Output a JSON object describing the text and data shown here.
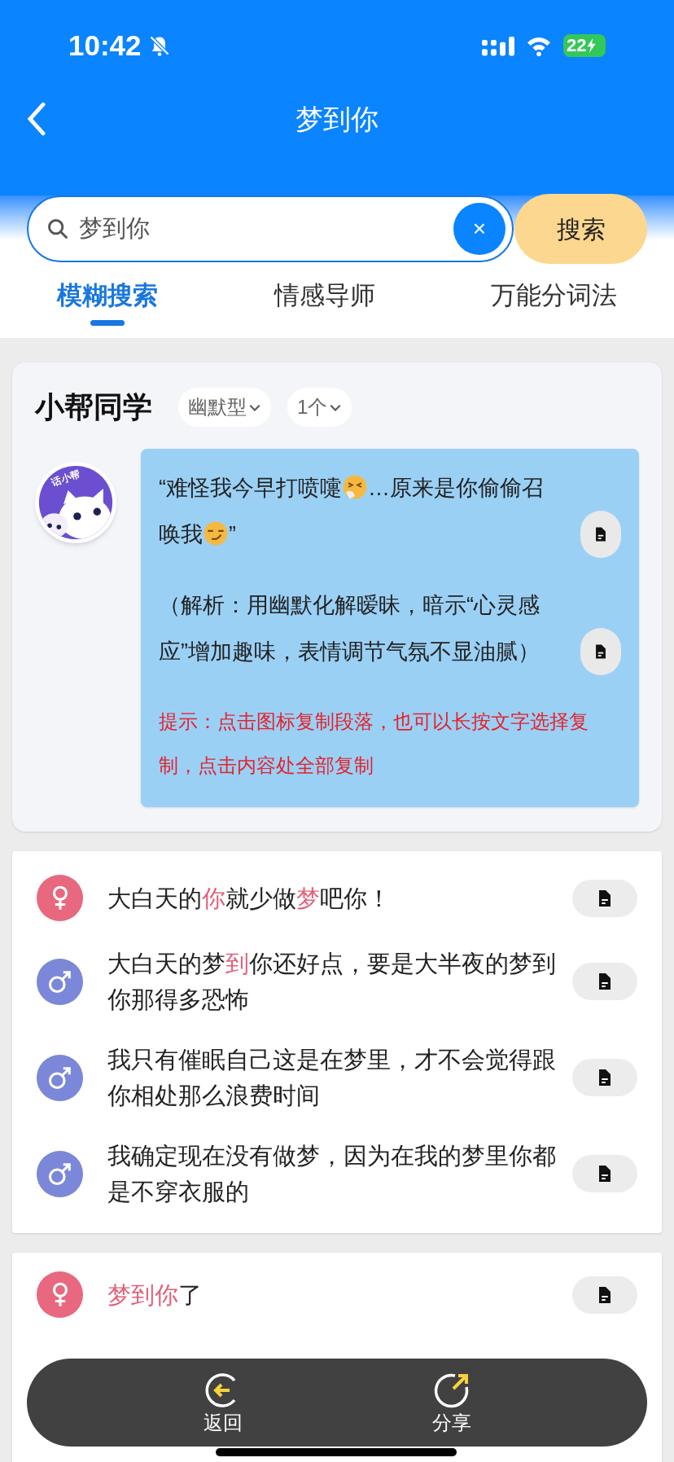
{
  "status_bar": {
    "time": "10:42",
    "battery": "22"
  },
  "header": {
    "title": "梦到你"
  },
  "search": {
    "value": "梦到你",
    "clear": "×",
    "button": "搜索"
  },
  "tabs": [
    {
      "label": "模糊搜索",
      "selected": true
    },
    {
      "label": "情感导师",
      "selected": false
    },
    {
      "label": "万能分词法",
      "selected": false
    }
  ],
  "assistant_card": {
    "title": "小帮同学",
    "filters": [
      "幽默型",
      "1个"
    ],
    "avatar_badge": "话小帮",
    "paragraphs": [
      {
        "kind": "quote",
        "parts": [
          {
            "kind": "text",
            "text": "“难怪我今早打喷嚏"
          },
          {
            "kind": "sneeze-emoji"
          },
          {
            "kind": "text",
            "text": "…原来是你偷偷召唤我"
          },
          {
            "kind": "smirk-emoji"
          },
          {
            "kind": "text",
            "text": "”"
          }
        ]
      },
      {
        "kind": "analysis",
        "parts": [
          {
            "kind": "text",
            "text": "（解析：用幽默化解暧昧，暗示“心灵感应”增加趣味，表情调节气氛不显油腻）"
          }
        ]
      },
      {
        "kind": "hint",
        "parts": [
          {
            "kind": "text",
            "text": "提示：点击图标复制段落，也可以长按文字选择复制，点击内容处全部复制"
          }
        ]
      }
    ]
  },
  "result_cards": [
    {
      "rows": [
        {
          "kind": "female",
          "parts": [
            {
              "text": "大白天的",
              "highlight": false
            },
            {
              "text": "你",
              "highlight": true
            },
            {
              "text": "就少做",
              "highlight": false
            },
            {
              "text": "梦",
              "highlight": true
            },
            {
              "text": "吧你！",
              "highlight": false
            }
          ]
        },
        {
          "kind": "male",
          "parts": [
            {
              "text": "大白天的梦",
              "highlight": false
            },
            {
              "text": "到",
              "highlight": true
            },
            {
              "text": "你还好点，要是大半夜的梦到你那得多恐怖",
              "highlight": false
            }
          ]
        },
        {
          "kind": "male",
          "parts": [
            {
              "text": "我只有催眠自己这是在梦里，才不会觉得跟你相处那么浪费时间",
              "highlight": false
            }
          ]
        },
        {
          "kind": "male",
          "parts": [
            {
              "text": "我确定现在没有做梦，因为在我的梦里你都是不穿衣服的",
              "highlight": false
            }
          ]
        }
      ]
    },
    {
      "rows": [
        {
          "kind": "female",
          "parts": [
            {
              "text": "梦到你",
              "highlight": true
            },
            {
              "text": "了",
              "highlight": false
            }
          ]
        }
      ]
    }
  ],
  "bottom_bar": [
    {
      "kind": "back",
      "label": "返回"
    },
    {
      "kind": "share",
      "label": "分享"
    }
  ]
}
